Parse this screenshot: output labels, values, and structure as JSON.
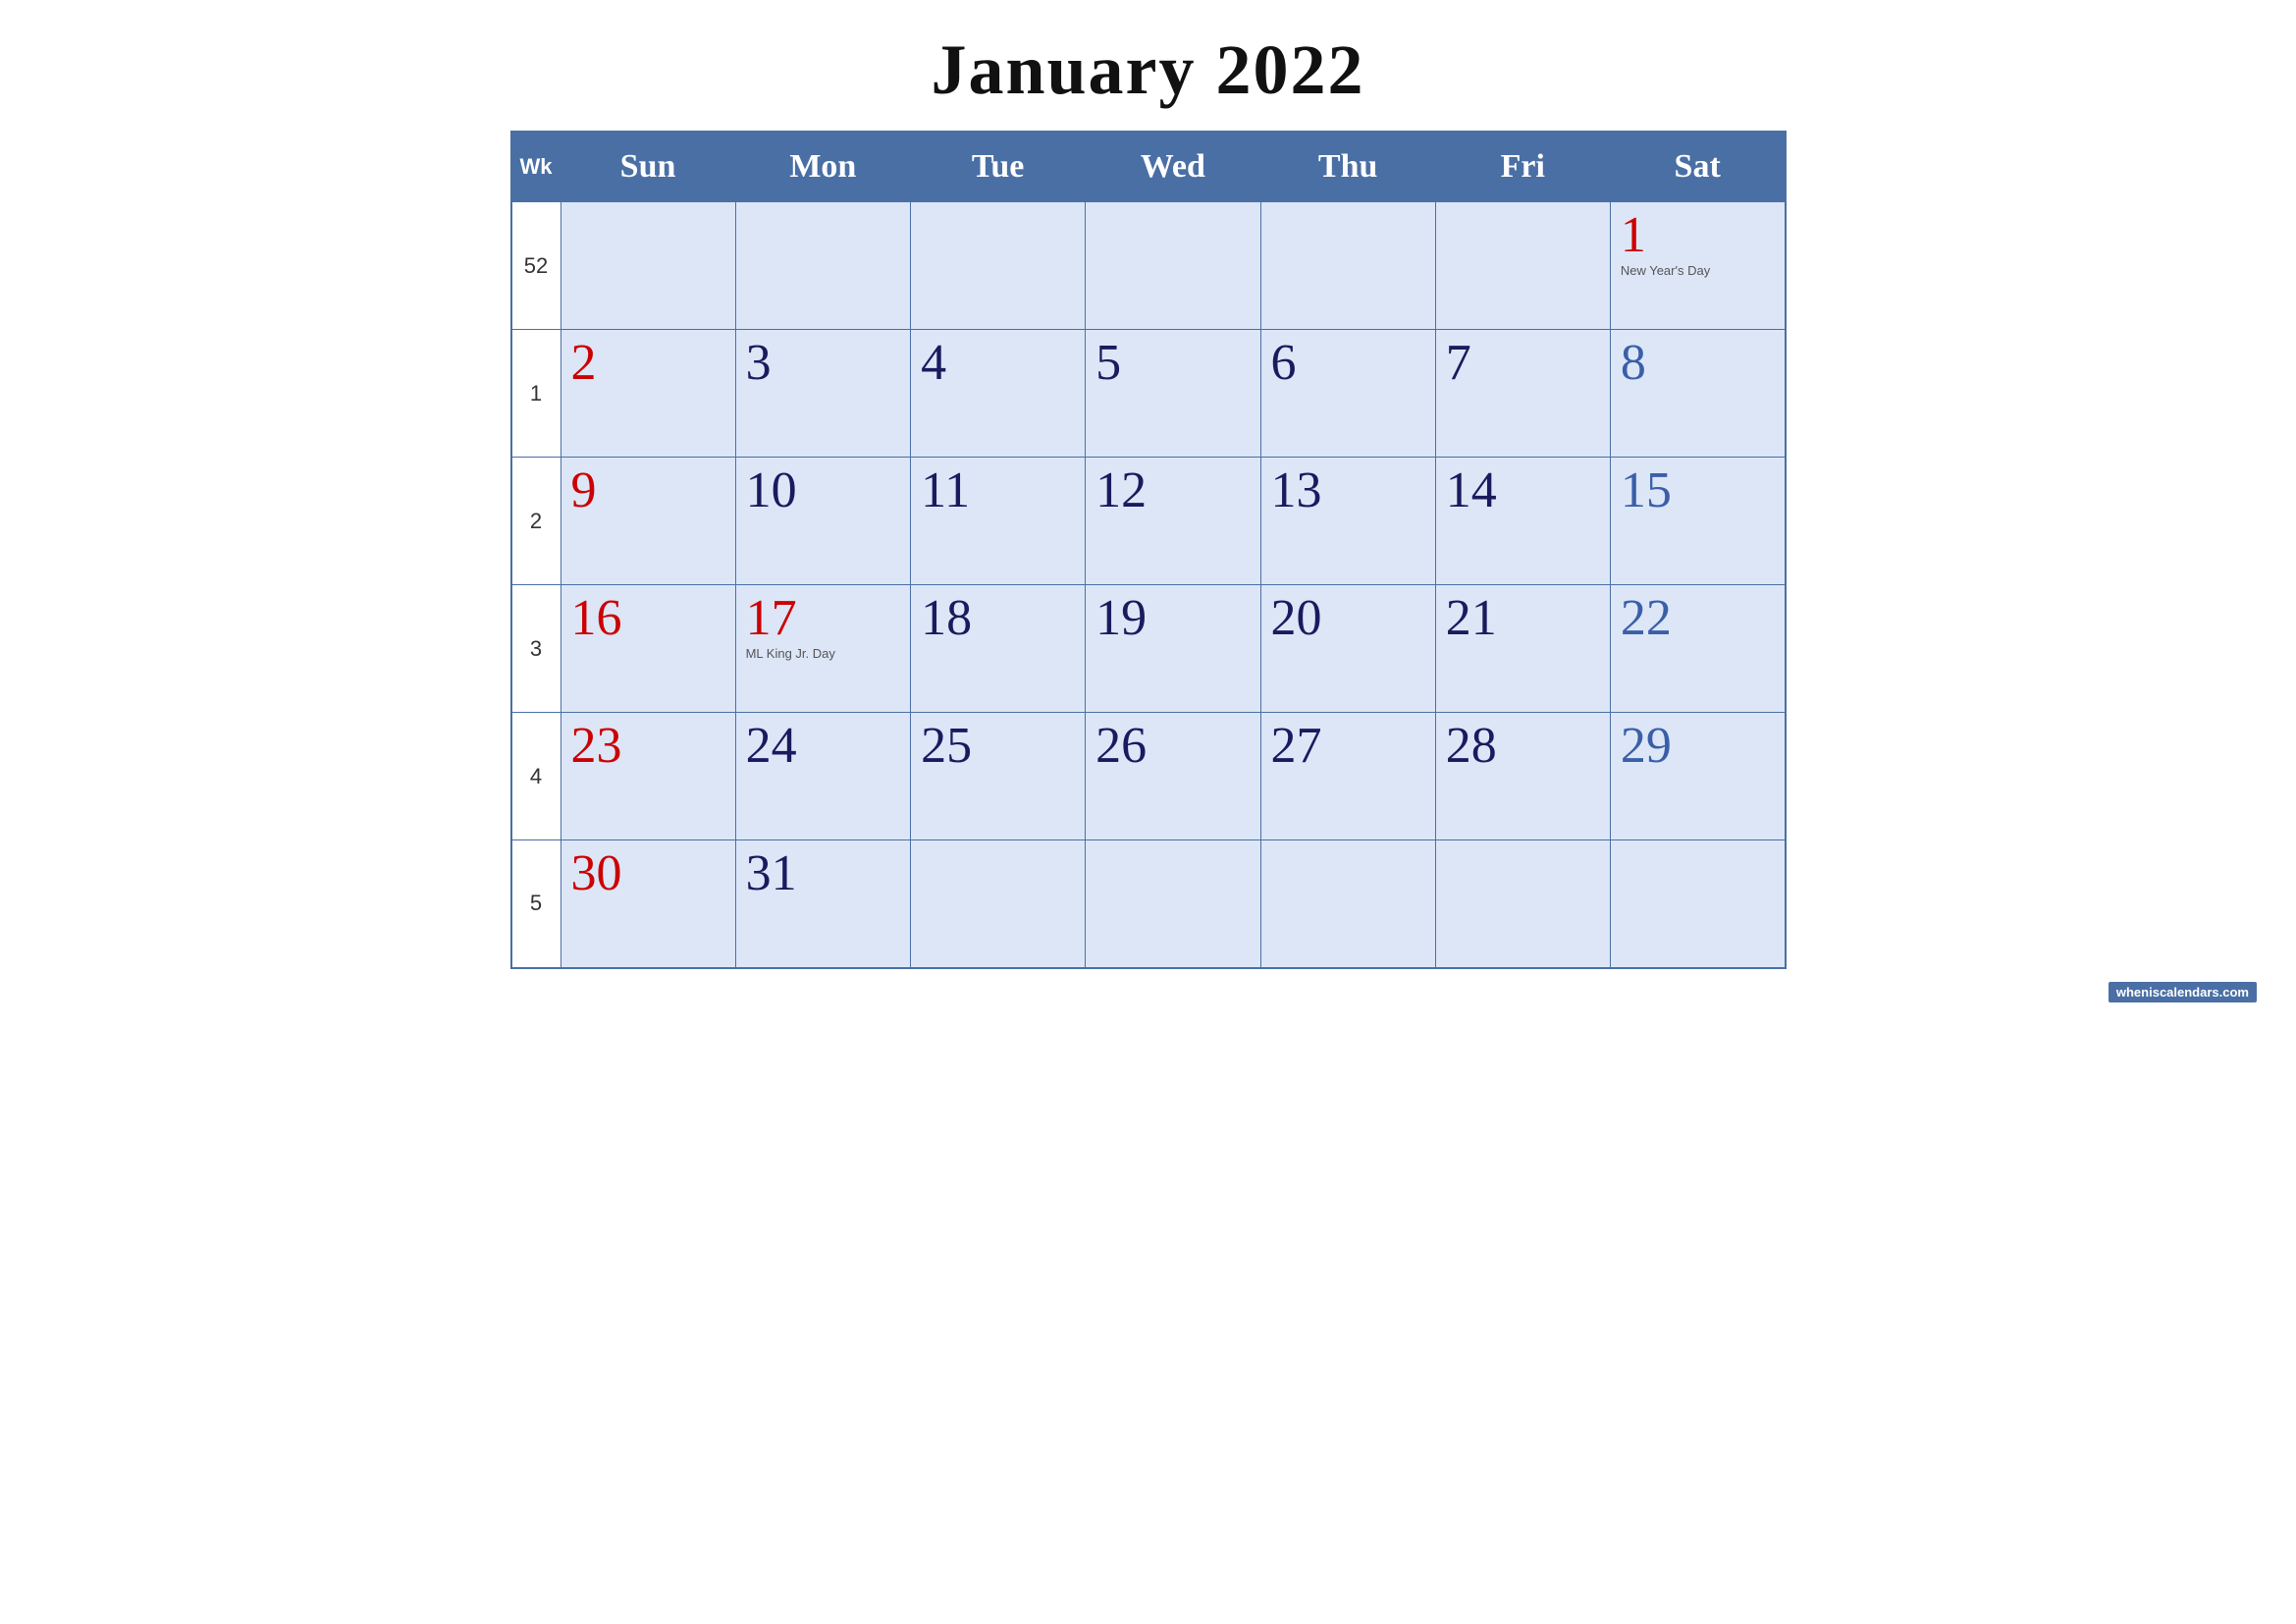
{
  "title": "January 2022",
  "header": {
    "columns": [
      {
        "label": "Wk",
        "class": "wk-header"
      },
      {
        "label": "Sun"
      },
      {
        "label": "Mon"
      },
      {
        "label": "Tue"
      },
      {
        "label": "Wed"
      },
      {
        "label": "Thu"
      },
      {
        "label": "Fri"
      },
      {
        "label": "Sat"
      }
    ]
  },
  "weeks": [
    {
      "wk": "52",
      "days": [
        {
          "num": "",
          "type": "empty"
        },
        {
          "num": "",
          "type": "empty"
        },
        {
          "num": "",
          "type": "empty"
        },
        {
          "num": "",
          "type": "empty"
        },
        {
          "num": "",
          "type": "empty"
        },
        {
          "num": "",
          "type": "empty"
        },
        {
          "num": "1",
          "type": "holiday",
          "holiday": "New Year's Day"
        }
      ]
    },
    {
      "wk": "1",
      "days": [
        {
          "num": "2",
          "type": "sunday"
        },
        {
          "num": "3",
          "type": "weekday"
        },
        {
          "num": "4",
          "type": "weekday"
        },
        {
          "num": "5",
          "type": "weekday"
        },
        {
          "num": "6",
          "type": "weekday"
        },
        {
          "num": "7",
          "type": "weekday"
        },
        {
          "num": "8",
          "type": "saturday"
        }
      ]
    },
    {
      "wk": "2",
      "days": [
        {
          "num": "9",
          "type": "sunday"
        },
        {
          "num": "10",
          "type": "weekday"
        },
        {
          "num": "11",
          "type": "weekday"
        },
        {
          "num": "12",
          "type": "weekday"
        },
        {
          "num": "13",
          "type": "weekday"
        },
        {
          "num": "14",
          "type": "weekday"
        },
        {
          "num": "15",
          "type": "saturday"
        }
      ]
    },
    {
      "wk": "3",
      "days": [
        {
          "num": "16",
          "type": "sunday"
        },
        {
          "num": "17",
          "type": "holiday",
          "holiday": "ML King Jr. Day"
        },
        {
          "num": "18",
          "type": "weekday"
        },
        {
          "num": "19",
          "type": "weekday"
        },
        {
          "num": "20",
          "type": "weekday"
        },
        {
          "num": "21",
          "type": "weekday"
        },
        {
          "num": "22",
          "type": "saturday"
        }
      ]
    },
    {
      "wk": "4",
      "days": [
        {
          "num": "23",
          "type": "sunday"
        },
        {
          "num": "24",
          "type": "weekday"
        },
        {
          "num": "25",
          "type": "weekday"
        },
        {
          "num": "26",
          "type": "weekday"
        },
        {
          "num": "27",
          "type": "weekday"
        },
        {
          "num": "28",
          "type": "weekday"
        },
        {
          "num": "29",
          "type": "saturday"
        }
      ]
    },
    {
      "wk": "5",
      "days": [
        {
          "num": "30",
          "type": "sunday"
        },
        {
          "num": "31",
          "type": "weekday"
        },
        {
          "num": "",
          "type": "empty"
        },
        {
          "num": "",
          "type": "empty"
        },
        {
          "num": "",
          "type": "empty"
        },
        {
          "num": "",
          "type": "empty"
        },
        {
          "num": "",
          "type": "empty"
        }
      ]
    }
  ],
  "watermark": {
    "text": "wheniscalendars.com",
    "url": "#"
  }
}
